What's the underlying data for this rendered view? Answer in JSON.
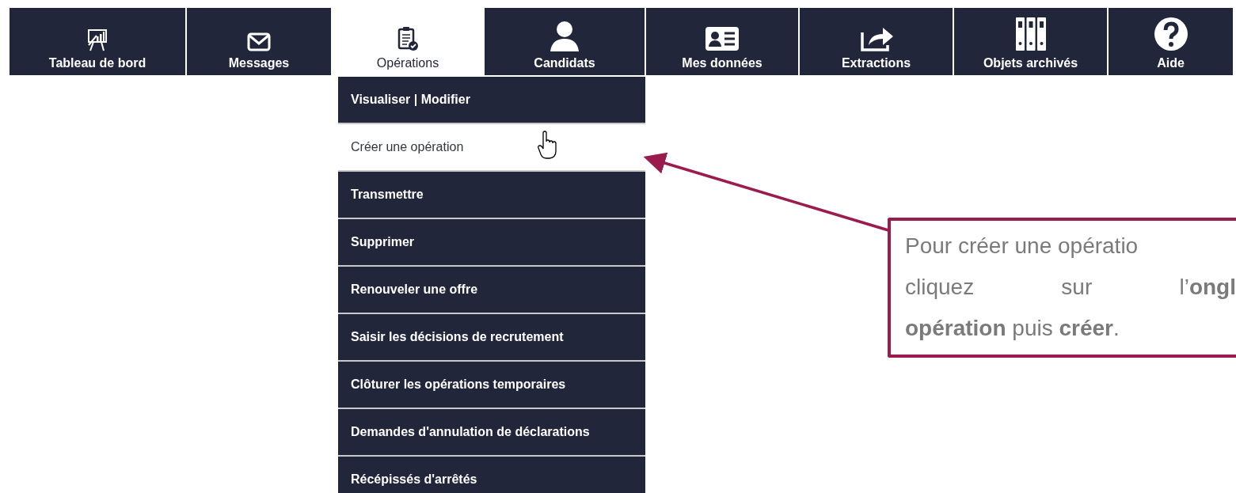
{
  "nav_tabs": [
    {
      "label": "Tableau de bord",
      "selected": false
    },
    {
      "label": "Messages",
      "selected": false
    },
    {
      "label": "Opérations",
      "selected": true
    },
    {
      "label": "Candidats",
      "selected": false
    },
    {
      "label": "Mes données",
      "selected": false
    },
    {
      "label": "Extractions",
      "selected": false
    },
    {
      "label": "Objets archivés",
      "selected": false
    },
    {
      "label": "Aide",
      "selected": false
    }
  ],
  "dropdown_menu": {
    "items": [
      {
        "label": "Visualiser | Modifier",
        "selected": false
      },
      {
        "label": "Créer une opération",
        "selected": true
      },
      {
        "label": "Transmettre",
        "selected": false
      },
      {
        "label": "Supprimer",
        "selected": false
      },
      {
        "label": "Renouveler une offre",
        "selected": false
      },
      {
        "label": "Saisir les décisions de recrutement",
        "selected": false
      },
      {
        "label": "Clôturer les opérations temporaires",
        "selected": false
      },
      {
        "label": "Demandes d'annulation de déclarations",
        "selected": false
      },
      {
        "label": "Récépissés d'arrêtés",
        "selected": false
      }
    ]
  },
  "callout": {
    "lines": [
      "Pour créer une opératio",
      "cliquez sur l’**ongl**",
      "**opération** puis **créer**."
    ]
  }
}
